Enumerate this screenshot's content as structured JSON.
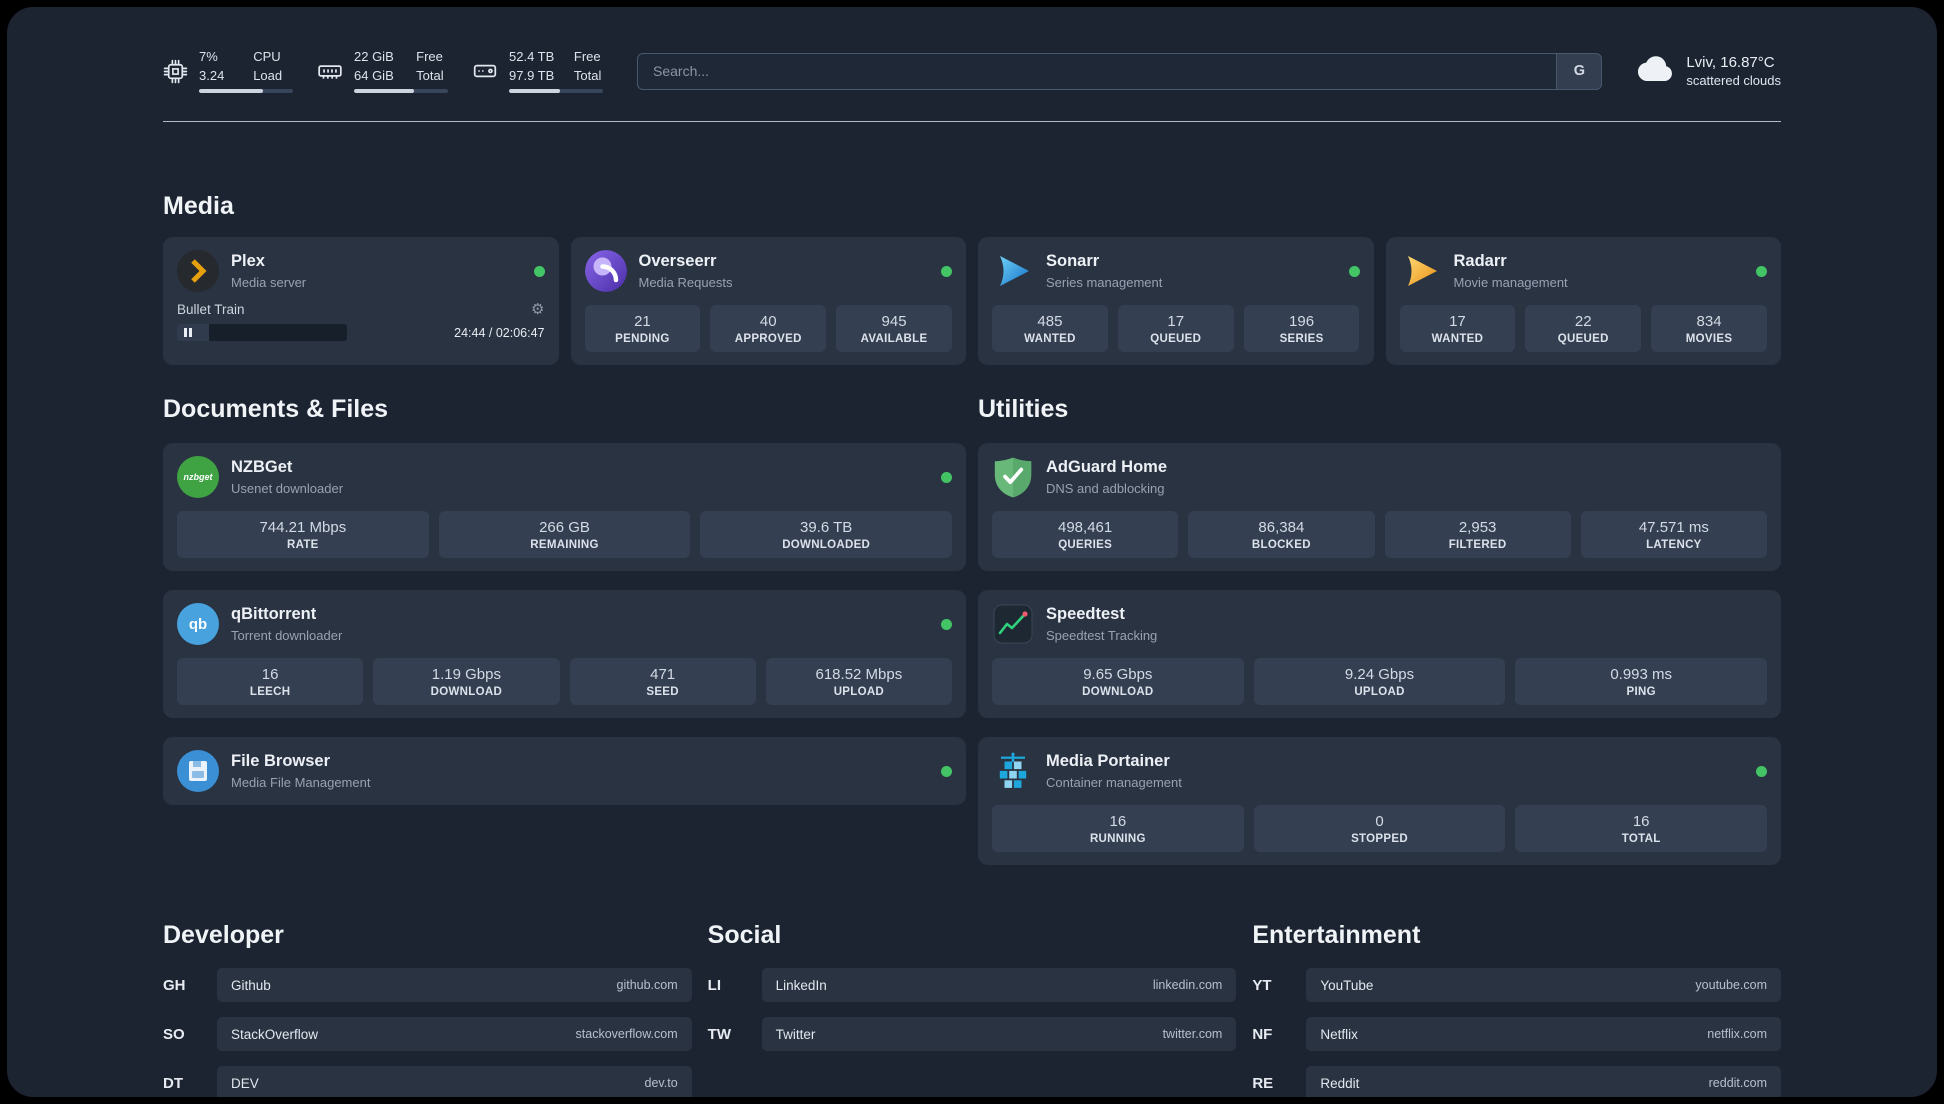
{
  "topbar": {
    "cpu": {
      "value1": "7%",
      "label1": "CPU",
      "value2": "3.24",
      "label2": "Load"
    },
    "ram": {
      "value1": "22 GiB",
      "label1": "Free",
      "value2": "64 GiB",
      "label2": "Total"
    },
    "disk": {
      "value1": "52.4 TB",
      "label1": "Free",
      "value2": "97.9 TB",
      "label2": "Total"
    },
    "search": {
      "placeholder": "Search...",
      "button_label": "G"
    },
    "weather": {
      "location": "Lviv, 16.87°C",
      "condition": "scattered clouds"
    }
  },
  "sections": {
    "media": {
      "title": "Media",
      "plex": {
        "name": "Plex",
        "subtitle": "Media server",
        "now_playing": "Bullet Train",
        "time": "24:44 / 02:06:47"
      },
      "overseerr": {
        "name": "Overseerr",
        "subtitle": "Media Requests",
        "stats": [
          {
            "value": "21",
            "label": "PENDING"
          },
          {
            "value": "40",
            "label": "APPROVED"
          },
          {
            "value": "945",
            "label": "AVAILABLE"
          }
        ]
      },
      "sonarr": {
        "name": "Sonarr",
        "subtitle": "Series management",
        "stats": [
          {
            "value": "485",
            "label": "WANTED"
          },
          {
            "value": "17",
            "label": "QUEUED"
          },
          {
            "value": "196",
            "label": "SERIES"
          }
        ]
      },
      "radarr": {
        "name": "Radarr",
        "subtitle": "Movie management",
        "stats": [
          {
            "value": "17",
            "label": "WANTED"
          },
          {
            "value": "22",
            "label": "QUEUED"
          },
          {
            "value": "834",
            "label": "MOVIES"
          }
        ]
      }
    },
    "documents": {
      "title": "Documents & Files",
      "nzbget": {
        "name": "NZBGet",
        "subtitle": "Usenet downloader",
        "icon_text": "nzbget",
        "stats": [
          {
            "value": "744.21 Mbps",
            "label": "RATE"
          },
          {
            "value": "266 GB",
            "label": "REMAINING"
          },
          {
            "value": "39.6 TB",
            "label": "DOWNLOADED"
          }
        ]
      },
      "qbittorrent": {
        "name": "qBittorrent",
        "subtitle": "Torrent downloader",
        "icon_text": "qb",
        "stats": [
          {
            "value": "16",
            "label": "LEECH"
          },
          {
            "value": "1.19 Gbps",
            "label": "DOWNLOAD"
          },
          {
            "value": "471",
            "label": "SEED"
          },
          {
            "value": "618.52 Mbps",
            "label": "UPLOAD"
          }
        ]
      },
      "filebrowser": {
        "name": "File Browser",
        "subtitle": "Media File Management"
      }
    },
    "utilities": {
      "title": "Utilities",
      "adguard": {
        "name": "AdGuard Home",
        "subtitle": "DNS and adblocking",
        "stats": [
          {
            "value": "498,461",
            "label": "QUERIES"
          },
          {
            "value": "86,384",
            "label": "BLOCKED"
          },
          {
            "value": "2,953",
            "label": "FILTERED"
          },
          {
            "value": "47.571 ms",
            "label": "LATENCY"
          }
        ]
      },
      "speedtest": {
        "name": "Speedtest",
        "subtitle": "Speedtest Tracking",
        "stats": [
          {
            "value": "9.65 Gbps",
            "label": "DOWNLOAD"
          },
          {
            "value": "9.24 Gbps",
            "label": "UPLOAD"
          },
          {
            "value": "0.993 ms",
            "label": "PING"
          }
        ]
      },
      "portainer": {
        "name": "Media Portainer",
        "subtitle": "Container management",
        "stats": [
          {
            "value": "16",
            "label": "RUNNING"
          },
          {
            "value": "0",
            "label": "STOPPED"
          },
          {
            "value": "16",
            "label": "TOTAL"
          }
        ]
      }
    },
    "bookmarks": {
      "developer": {
        "title": "Developer",
        "items": [
          {
            "abbr": "GH",
            "name": "Github",
            "url": "github.com"
          },
          {
            "abbr": "SO",
            "name": "StackOverflow",
            "url": "stackoverflow.com"
          },
          {
            "abbr": "DT",
            "name": "DEV",
            "url": "dev.to"
          }
        ]
      },
      "social": {
        "title": "Social",
        "items": [
          {
            "abbr": "LI",
            "name": "LinkedIn",
            "url": "linkedin.com"
          },
          {
            "abbr": "TW",
            "name": "Twitter",
            "url": "twitter.com"
          }
        ]
      },
      "entertainment": {
        "title": "Entertainment",
        "items": [
          {
            "abbr": "YT",
            "name": "YouTube",
            "url": "youtube.com"
          },
          {
            "abbr": "NF",
            "name": "Netflix",
            "url": "netflix.com"
          },
          {
            "abbr": "RE",
            "name": "Reddit",
            "url": "reddit.com"
          }
        ]
      }
    }
  },
  "colors": {
    "background": "#1c2432",
    "card": "#2a3342",
    "stat_box": "#343f52",
    "status_online": "#43c565",
    "plex_amber": "#e5a00d",
    "overseerr_purple": "#6747d6",
    "sonarr_blue": "#35a6e8",
    "radarr_amber": "#f0a63a",
    "nzbget_green": "#3fa344",
    "qbittorrent_blue": "#47a2dd",
    "filebrowser_blue": "#3b8fd4",
    "adguard_green": "#68b87a",
    "speedtest_green": "#2fd27d",
    "portainer_blue": "#1ea7dd"
  }
}
